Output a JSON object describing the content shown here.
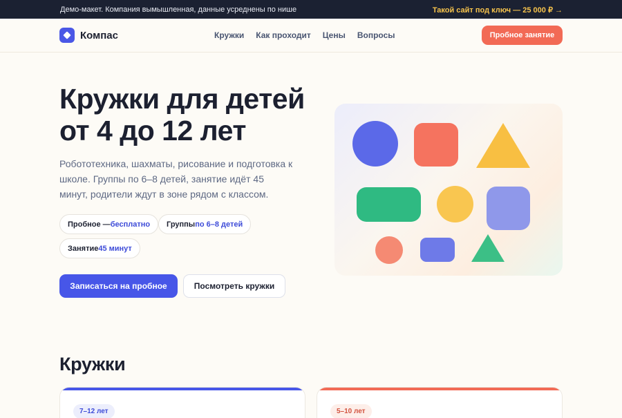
{
  "topbar": {
    "note": "Демо-макет. Компания вымышленная, данные усреднены по нише",
    "promo": "Такой сайт под ключ — 25 000 ₽ →"
  },
  "brand": {
    "name": "Компас",
    "accent": "#4a57e6",
    "coral": "#f26a55"
  },
  "nav": {
    "items": [
      {
        "label": "Кружки"
      },
      {
        "label": "Как проходит"
      },
      {
        "label": "Цены"
      },
      {
        "label": "Вопросы"
      }
    ],
    "cta": "Пробное занятие"
  },
  "hero": {
    "title_line1": "Кружки для детей",
    "title_line2": "от 4 до 12 лет",
    "description": "Робототехника, шахматы, рисование и подготовка к школе. Группы по 6–8 детей, занятие идёт 45 минут, родители ждут в зоне рядом с классом.",
    "chips": [
      {
        "label": "Пробное — ",
        "value": "бесплатно"
      },
      {
        "label": "Группы ",
        "value": "по 6–8 детей"
      },
      {
        "label": "Занятие ",
        "value": "45 минут"
      }
    ],
    "primary_button": "Записаться на пробное",
    "secondary_button": "Посмотреть кружки"
  },
  "illustration": {
    "shapes": [
      {
        "name": "blue-circle-shape",
        "color": "#5b69e8"
      },
      {
        "name": "coral-square-shape",
        "color": "#f5735f"
      },
      {
        "name": "yellow-triangle-shape",
        "color": "#f8bf42"
      },
      {
        "name": "green-pill-shape",
        "color": "#2fba82"
      },
      {
        "name": "yellow-circle-shape",
        "color": "#f9c650"
      },
      {
        "name": "lilac-square-shape",
        "color": "#8f98ea"
      },
      {
        "name": "coral-small-circle-shape",
        "color": "#f58a73"
      },
      {
        "name": "blue-small-rect-shape",
        "color": "#6e7ae8"
      },
      {
        "name": "green-small-triangle-shape",
        "color": "#3cbf86"
      }
    ]
  },
  "section": {
    "title": "Кружки"
  },
  "cards": [
    {
      "age": "7–12 лет",
      "bar_color": "#4756e8",
      "badge_bg": "#eceefc",
      "badge_color": "#3d4bd8"
    },
    {
      "age": "5–10 лет",
      "bar_color": "#f26a55",
      "badge_bg": "#fdeee9",
      "badge_color": "#d2533f"
    }
  ]
}
